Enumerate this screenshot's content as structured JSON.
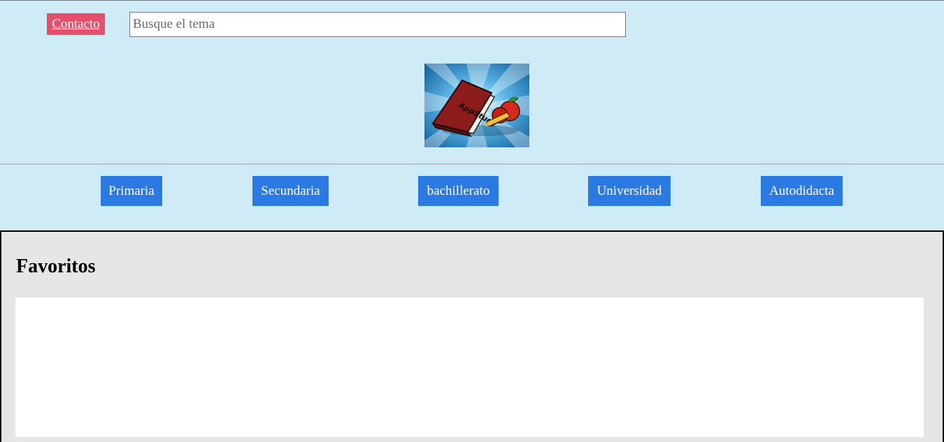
{
  "header": {
    "contact_label": "Contacto",
    "search": {
      "placeholder": "Busque el tema",
      "value": ""
    },
    "logo_icon": "book-apple-logo",
    "logo_text": "AppStudy"
  },
  "nav": {
    "items": [
      {
        "label": "Primaria"
      },
      {
        "label": "Secundaria"
      },
      {
        "label": "bachillerato"
      },
      {
        "label": "Universidad"
      },
      {
        "label": "Autodidacta"
      }
    ]
  },
  "main": {
    "title": "Favoritos"
  },
  "colors": {
    "page_bg": "#cfebf5",
    "contact_bg": "#e4506b",
    "nav_bg": "#2b7ae4",
    "main_bg": "#e6e6e6"
  }
}
